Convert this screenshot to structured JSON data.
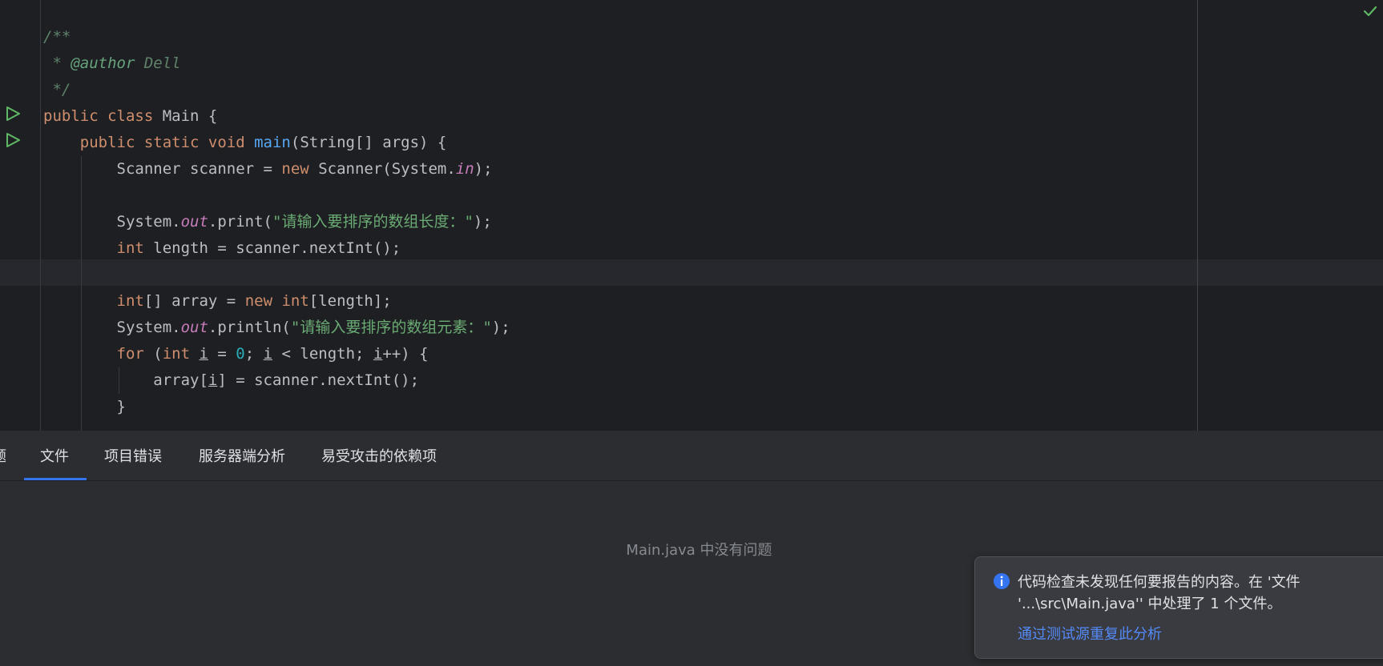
{
  "editor": {
    "lines": [
      [
        {
          "t": "/**",
          "c": "cmt"
        }
      ],
      [
        {
          "t": " * ",
          "c": "cmt"
        },
        {
          "t": "@author",
          "c": "tag"
        },
        {
          "t": " Dell",
          "c": "cmt"
        }
      ],
      [
        {
          "t": " */",
          "c": "cmt"
        }
      ],
      [
        {
          "t": "public class ",
          "c": "kw"
        },
        {
          "t": "Main {",
          "c": "cls"
        }
      ],
      [
        {
          "t": "    public static void ",
          "c": "kw"
        },
        {
          "t": "main",
          "c": "fn"
        },
        {
          "t": "(String[] args) {",
          "c": "cls"
        }
      ],
      [
        {
          "t": "        Scanner scanner = ",
          "c": "cls"
        },
        {
          "t": "new ",
          "c": "kw"
        },
        {
          "t": "Scanner(System.",
          "c": "cls"
        },
        {
          "t": "in",
          "c": "st"
        },
        {
          "t": ");",
          "c": "cls"
        }
      ],
      [],
      [
        {
          "t": "        System.",
          "c": "cls"
        },
        {
          "t": "out",
          "c": "st"
        },
        {
          "t": ".print(",
          "c": "cls"
        },
        {
          "t": "\"请输入要排序的数组长度：\"",
          "c": "str"
        },
        {
          "t": ");",
          "c": "cls"
        }
      ],
      [
        {
          "t": "        ",
          "c": "cls"
        },
        {
          "t": "int ",
          "c": "kw"
        },
        {
          "t": "length = scanner.nextInt();",
          "c": "cls"
        }
      ],
      [],
      [
        {
          "t": "        ",
          "c": "cls"
        },
        {
          "t": "int",
          "c": "kw"
        },
        {
          "t": "[] array = ",
          "c": "cls"
        },
        {
          "t": "new int",
          "c": "kw"
        },
        {
          "t": "[length];",
          "c": "cls"
        }
      ],
      [
        {
          "t": "        System.",
          "c": "cls"
        },
        {
          "t": "out",
          "c": "st"
        },
        {
          "t": ".println(",
          "c": "cls"
        },
        {
          "t": "\"请输入要排序的数组元素：\"",
          "c": "str"
        },
        {
          "t": ");",
          "c": "cls"
        }
      ],
      [
        {
          "t": "        ",
          "c": "cls"
        },
        {
          "t": "for ",
          "c": "kw"
        },
        {
          "t": "(",
          "c": "cls"
        },
        {
          "t": "int ",
          "c": "kw"
        },
        {
          "t": "i",
          "c": "cls ul"
        },
        {
          "t": " = ",
          "c": "cls"
        },
        {
          "t": "0",
          "c": "num"
        },
        {
          "t": "; ",
          "c": "cls"
        },
        {
          "t": "i",
          "c": "cls ul"
        },
        {
          "t": " < length; ",
          "c": "cls"
        },
        {
          "t": "i",
          "c": "cls ul"
        },
        {
          "t": "++) {",
          "c": "cls"
        }
      ],
      [
        {
          "t": "            array[",
          "c": "cls"
        },
        {
          "t": "i",
          "c": "cls ul"
        },
        {
          "t": "] = scanner.nextInt();",
          "c": "cls"
        }
      ],
      [
        {
          "t": "        }",
          "c": "cls"
        }
      ]
    ],
    "run_icon": "run-triangle-icon",
    "inspection_icon": "checkmark-icon"
  },
  "problems": {
    "tabs": [
      {
        "label": "题",
        "active": false
      },
      {
        "label": "文件",
        "active": true
      },
      {
        "label": "项目错误",
        "active": false
      },
      {
        "label": "服务器端分析",
        "active": false
      },
      {
        "label": "易受攻击的依赖项",
        "active": false
      }
    ],
    "empty_message": "Main.java 中没有问题",
    "accent_color": "#3574f0"
  },
  "notification": {
    "icon": "info-icon",
    "text": "代码检查未发现任何要报告的内容。在 '文件 '...\\src\\Main.java'' 中处理了 1 个文件。",
    "link": "通过测试源重复此分析"
  }
}
